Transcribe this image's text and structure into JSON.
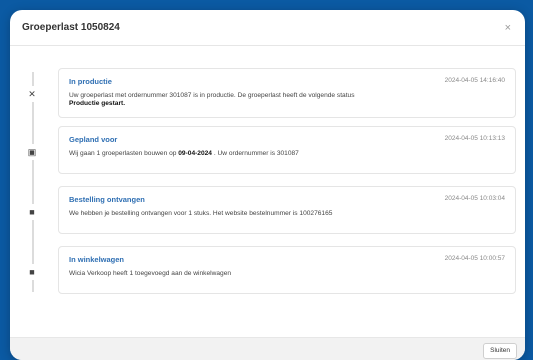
{
  "modal": {
    "title": "Groeperlast 1050824",
    "close_symbol": "×",
    "footer_button": "Sluiten"
  },
  "timeline": [
    {
      "icon": "✕",
      "icon_name": "cross-icon",
      "title": "In productie",
      "time": "2024-04-05 14:16:40",
      "text_line1": "Uw groeperlast met ordernummer 301087 is in productie. De groeperlast heeft de volgende status",
      "text_bold": "Productie gestart."
    },
    {
      "icon": "▣",
      "icon_name": "calendar-icon",
      "title": "Gepland voor",
      "time": "2024-04-05 10:13:13",
      "text_prefix": "Wij gaan 1 groeperlasten bouwen op ",
      "text_date": "09-04-2024",
      "text_suffix": ". Uw ordernummer is 301087"
    },
    {
      "icon": "■",
      "icon_name": "box-icon",
      "title": "Bestelling ontvangen",
      "time": "2024-04-05 10:03:04",
      "text_line1": "We hebben je bestelling ontvangen voor 1 stuks. Het website bestelnummer is 100276165"
    },
    {
      "icon": "■",
      "icon_name": "cart-icon",
      "title": "In winkelwagen",
      "time": "2024-04-05 10:00:57",
      "text_line1": "Wicia Verkoop heeft 1 toegevoegd aan de winkelwagen"
    }
  ]
}
